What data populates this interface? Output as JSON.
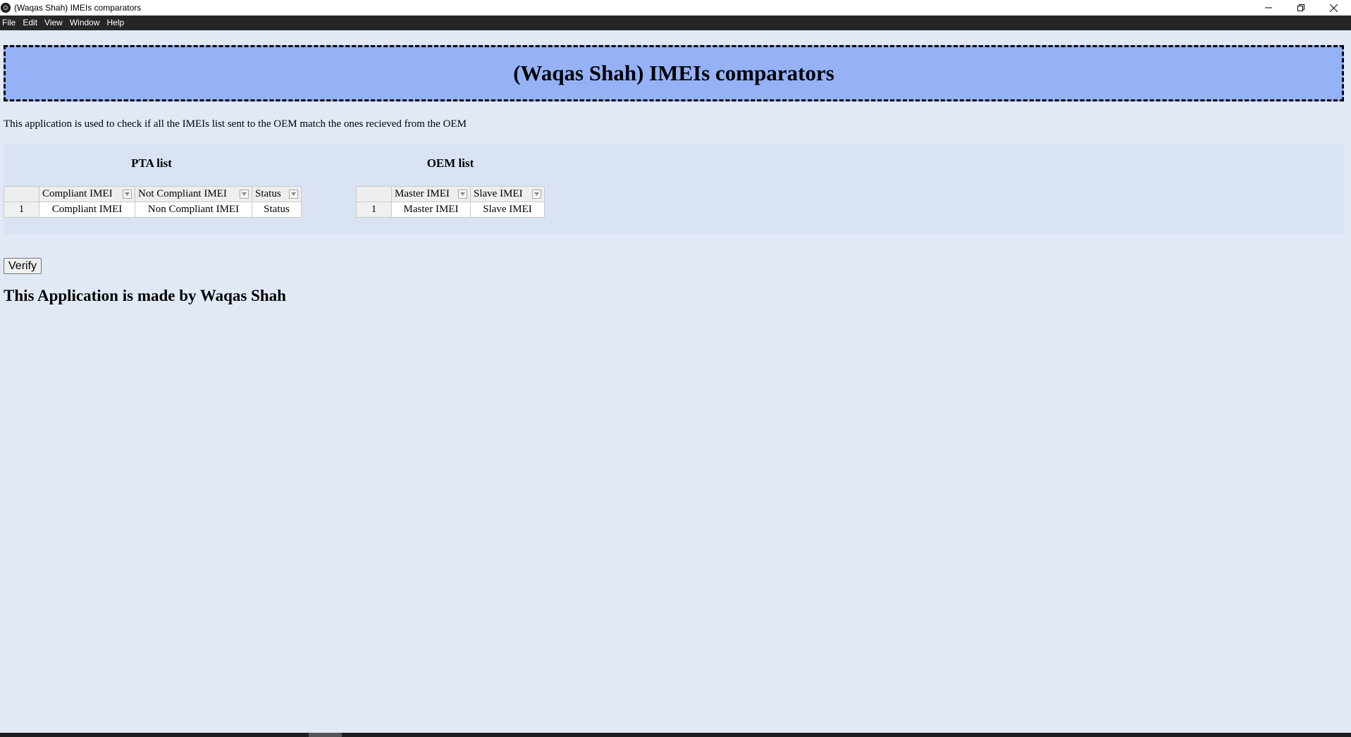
{
  "window": {
    "title": "(Waqas Shah) IMEIs comparators"
  },
  "menubar": {
    "items": [
      "File",
      "Edit",
      "View",
      "Window",
      "Help"
    ]
  },
  "header": {
    "title": "(Waqas Shah) IMEIs comparators"
  },
  "description": "This application is used to check if all the IMEIs list sent to the OEM match the ones recieved from the OEM",
  "pta_table": {
    "title": "PTA list",
    "columns": [
      "Compliant IMEI",
      "Not Compliant IMEI",
      "Status"
    ],
    "rows": [
      {
        "index": "1",
        "cells": [
          "Compliant IMEI",
          "Non Compliant IMEI",
          "Status"
        ]
      }
    ]
  },
  "oem_table": {
    "title": "OEM list",
    "columns": [
      "Master IMEI",
      "Slave IMEI"
    ],
    "rows": [
      {
        "index": "1",
        "cells": [
          "Master IMEI",
          "Slave IMEI"
        ]
      }
    ]
  },
  "verify_button": {
    "label": "Verify"
  },
  "footer": {
    "text": "This Application is made by Waqas Shah"
  },
  "colors": {
    "background": "#e1e9f7",
    "banner": "#95b2f7",
    "menubar": "#262626"
  }
}
